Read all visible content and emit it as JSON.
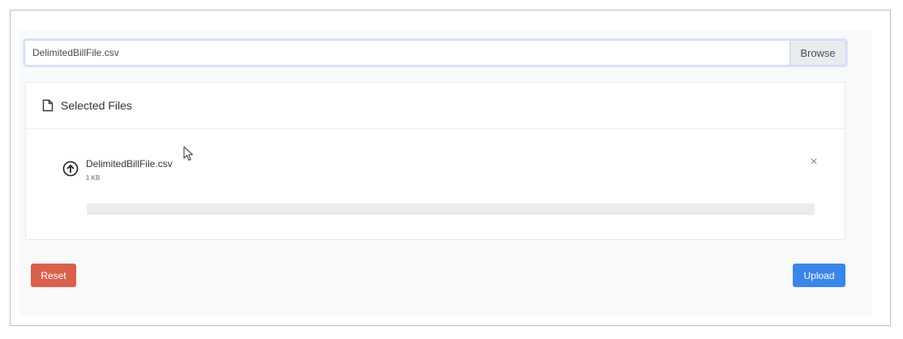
{
  "file_input": {
    "value": "DelimitedBillFile.csv",
    "browse_label": "Browse"
  },
  "selected_files": {
    "title": "Selected Files",
    "icon": "file-icon",
    "items": [
      {
        "name": "DelimitedBillFile.csv",
        "size": "1 KB",
        "status_icon": "upload-arrow-icon",
        "remove_icon": "×",
        "progress_percent": 0
      }
    ]
  },
  "actions": {
    "reset_label": "Reset",
    "upload_label": "Upload"
  },
  "colors": {
    "reset": "#d9604c",
    "upload": "#3a86e8",
    "input_focus": "#dbe6fb"
  }
}
